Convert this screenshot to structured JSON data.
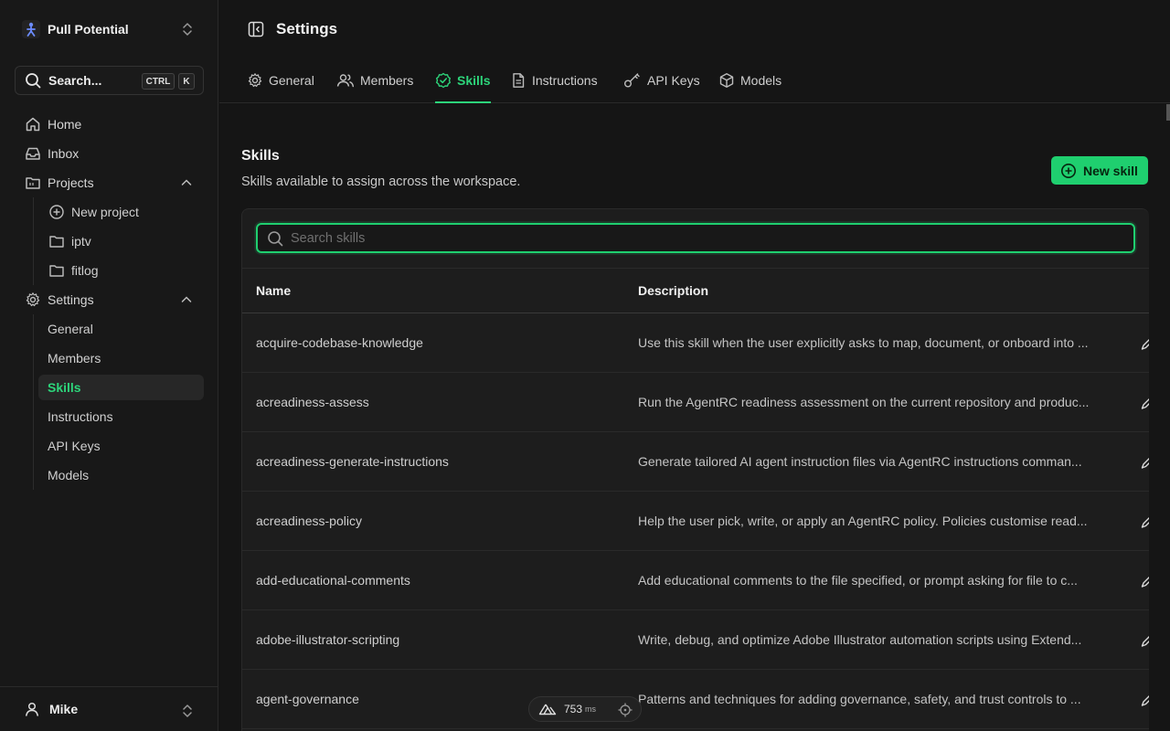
{
  "workspace": {
    "name": "Pull Potential"
  },
  "search": {
    "label": "Search...",
    "kbd_ctrl": "CTRL",
    "kbd_key": "K"
  },
  "nav": {
    "home": "Home",
    "inbox": "Inbox",
    "projects": "Projects",
    "new_project": "New project",
    "project_items": [
      "iptv",
      "fitlog"
    ],
    "settings": "Settings",
    "settings_items": [
      "General",
      "Members",
      "Skills",
      "Instructions",
      "API Keys",
      "Models"
    ]
  },
  "user": {
    "name": "Mike"
  },
  "header": {
    "title": "Settings"
  },
  "tabs": [
    "General",
    "Members",
    "Skills",
    "Instructions",
    "API Keys",
    "Models"
  ],
  "section": {
    "title": "Skills",
    "subtitle": "Skills available to assign across the workspace.",
    "new_button": "New skill",
    "search_placeholder": "Search skills"
  },
  "table": {
    "columns": [
      "Name",
      "Description"
    ],
    "rows": [
      {
        "name": "acquire-codebase-knowledge",
        "description": "Use this skill when the user explicitly asks to map, document, or onboard into ..."
      },
      {
        "name": "acreadiness-assess",
        "description": "Run the AgentRC readiness assessment on the current repository and produc..."
      },
      {
        "name": "acreadiness-generate-instructions",
        "description": "Generate tailored AI agent instruction files via AgentRC instructions comman..."
      },
      {
        "name": "acreadiness-policy",
        "description": "Help the user pick, write, or apply an AgentRC policy. Policies customise read..."
      },
      {
        "name": "add-educational-comments",
        "description": "Add educational comments to the file specified, or prompt asking for file to c..."
      },
      {
        "name": "adobe-illustrator-scripting",
        "description": "Write, debug, and optimize Adobe Illustrator automation scripts using Extend..."
      },
      {
        "name": "agent-governance",
        "description": "Patterns and techniques for adding governance, safety, and trust controls to ..."
      }
    ]
  },
  "perf": {
    "value": "753",
    "unit": "ms"
  },
  "colors": {
    "accent": "#1fcf6f",
    "background": "#151515",
    "sidebar": "#181818"
  }
}
